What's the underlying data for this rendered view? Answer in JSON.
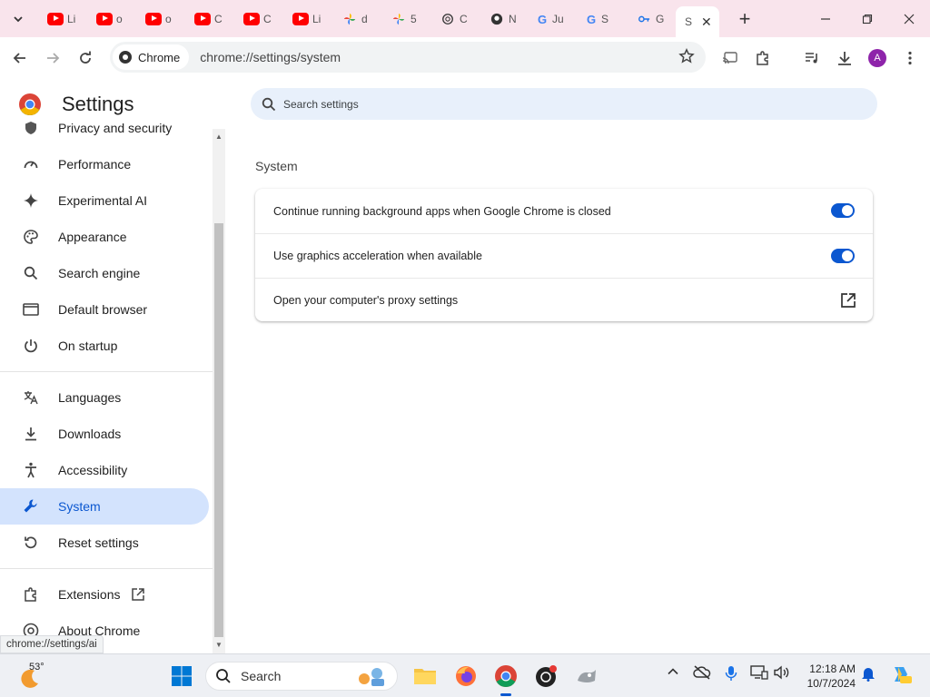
{
  "browser": {
    "tabs": [
      {
        "icon": "youtube-icon",
        "label": "Li"
      },
      {
        "icon": "youtube-icon",
        "label": "o"
      },
      {
        "icon": "youtube-icon",
        "label": "o"
      },
      {
        "icon": "youtube-icon",
        "label": "C"
      },
      {
        "icon": "youtube-icon",
        "label": "C"
      },
      {
        "icon": "youtube-icon",
        "label": "Li"
      },
      {
        "icon": "pinwheel-icon",
        "label": "d"
      },
      {
        "icon": "pinwheel-icon",
        "label": "5"
      },
      {
        "icon": "openai-icon",
        "label": "C"
      },
      {
        "icon": "github-icon",
        "label": "N"
      },
      {
        "icon": "google-icon",
        "label": "Ju"
      },
      {
        "icon": "google-icon",
        "label": "S"
      },
      {
        "icon": "key-icon",
        "label": "G"
      },
      {
        "icon": "settings-icon",
        "label": "S",
        "active": true
      }
    ],
    "chip_label": "Chrome",
    "url": "chrome://settings/system",
    "avatar_letter": "A"
  },
  "settings": {
    "title": "Settings",
    "search_placeholder": "Search settings",
    "sidebar": [
      {
        "label": "Privacy and security",
        "icon": "shield-icon"
      },
      {
        "label": "Performance",
        "icon": "speedometer-icon"
      },
      {
        "label": "Experimental AI",
        "icon": "sparkle-icon"
      },
      {
        "label": "Appearance",
        "icon": "palette-icon"
      },
      {
        "label": "Search engine",
        "icon": "search-icon"
      },
      {
        "label": "Default browser",
        "icon": "browser-window-icon"
      },
      {
        "label": "On startup",
        "icon": "power-icon"
      },
      {
        "label": "Languages",
        "icon": "translate-icon"
      },
      {
        "label": "Downloads",
        "icon": "download-icon"
      },
      {
        "label": "Accessibility",
        "icon": "accessibility-icon"
      },
      {
        "label": "System",
        "icon": "wrench-icon",
        "selected": true
      },
      {
        "label": "Reset settings",
        "icon": "reset-icon"
      },
      {
        "label": "Extensions",
        "icon": "puzzle-icon"
      },
      {
        "label": "About Chrome",
        "icon": "chrome-icon"
      }
    ],
    "section_title": "System",
    "rows": [
      {
        "label": "Continue running background apps when Google Chrome is closed",
        "control": "toggle",
        "checked": true
      },
      {
        "label": "Use graphics acceleration when available",
        "control": "toggle",
        "checked": true
      },
      {
        "label": "Open your computer's proxy settings",
        "control": "external-link"
      }
    ],
    "status_url": "chrome://settings/ai"
  },
  "taskbar": {
    "weather_temp": "53°",
    "search_placeholder": "Search",
    "time": "12:18 AM",
    "date": "10/7/2024"
  },
  "colors": {
    "tabstrip": "#f9e4ec",
    "accent": "#0b57d0",
    "selected_bg": "#d3e3fd",
    "search_bg": "#e8f0fb"
  }
}
